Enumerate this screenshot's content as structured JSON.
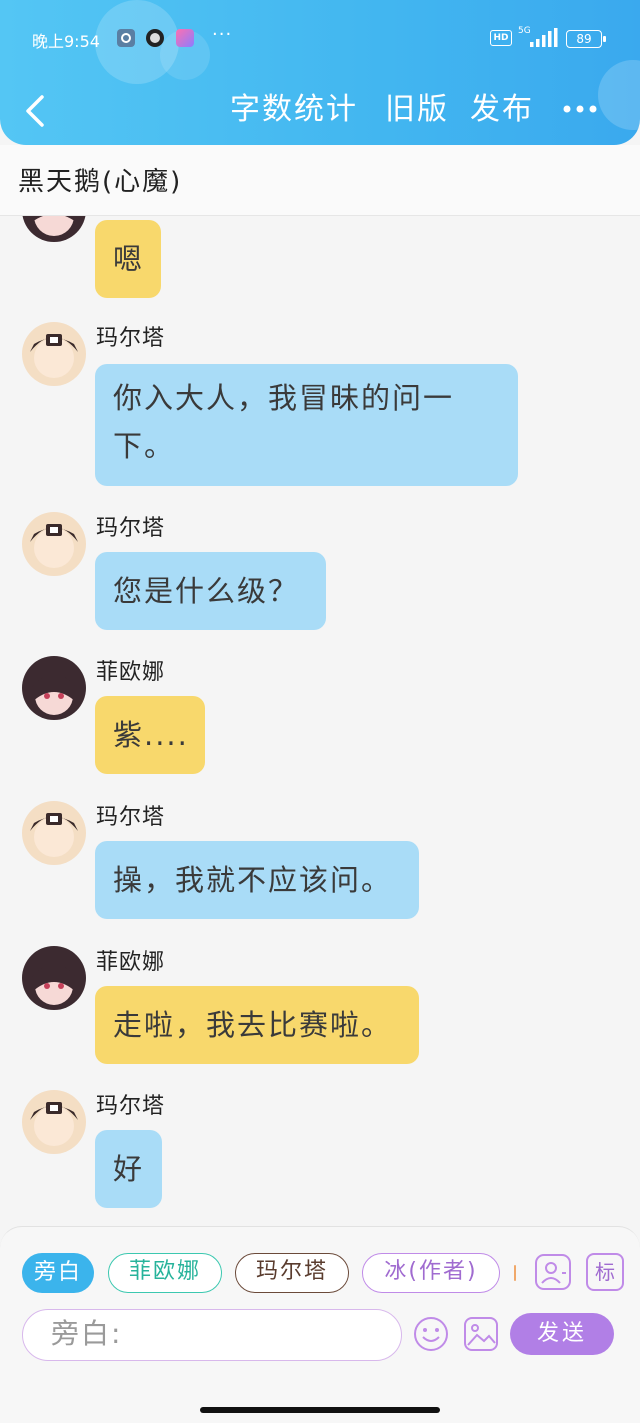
{
  "status_bar": {
    "time": "晚上9:54",
    "network": "5G",
    "hd": "HD",
    "battery": "89",
    "more": "···"
  },
  "nav": {
    "back_icon": "chevron-left",
    "word_count": "字数统计",
    "old_version": "旧版",
    "publish": "发布",
    "more_icon": "more-dots"
  },
  "conversation": {
    "title": "黑天鹅(心魔)"
  },
  "messages": [
    {
      "sender": "",
      "text": "嗯",
      "color": "#f8d86c",
      "avatar": "fiona-avatar"
    },
    {
      "sender": "玛尔塔",
      "text": "你入大人，我冒昧的问一",
      "text2": "下。",
      "color": "#a9dcf7",
      "avatar": "marta-avatar"
    },
    {
      "sender": "玛尔塔",
      "text": "您是什么级？",
      "color": "#a9dcf7",
      "avatar": "marta-avatar"
    },
    {
      "sender": "菲欧娜",
      "text": "紫....",
      "color": "#f8d86c",
      "avatar": "fiona-avatar"
    },
    {
      "sender": "玛尔塔",
      "text": "操，我就不应该问。",
      "color": "#a9dcf7",
      "avatar": "marta-avatar"
    },
    {
      "sender": "菲欧娜",
      "text": "走啦，我去比赛啦。",
      "color": "#f8d86c",
      "avatar": "fiona-avatar"
    },
    {
      "sender": "玛尔塔",
      "text": "好",
      "color": "#a9dcf7",
      "avatar": "marta-avatar"
    }
  ],
  "footer": {
    "roles": [
      {
        "label": "旁白",
        "selected": true
      },
      {
        "label": "菲欧娜",
        "selected": false
      },
      {
        "label": "玛尔塔",
        "selected": false
      },
      {
        "label": "冰(作者)",
        "selected": false
      }
    ],
    "tag_label": "标",
    "input_placeholder": "旁白:",
    "send_label": "发送"
  },
  "colors": {
    "header": "#42b6f0",
    "blue_bubble": "#a9dcf7",
    "yellow_bubble": "#f8d86c",
    "send": "#b17fe6"
  }
}
